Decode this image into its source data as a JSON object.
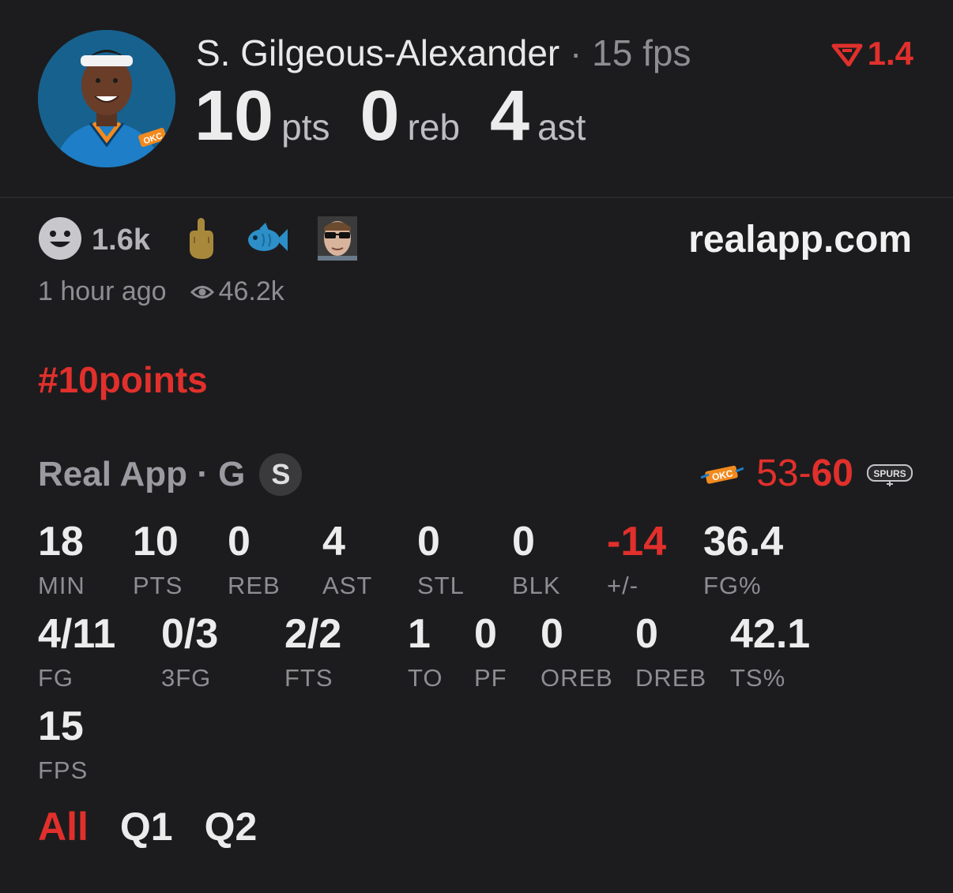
{
  "header": {
    "player_name": "S. Gilgeous-Alexander",
    "separator": "·",
    "fps_label": "15 fps",
    "pts": "10",
    "pts_unit": "pts",
    "reb": "0",
    "reb_unit": "reb",
    "ast": "4",
    "ast_unit": "ast",
    "delta": "1.4",
    "team_logo_text": "OKC"
  },
  "reactions": {
    "count": "1.6k",
    "items": [
      "smiley-icon",
      "middle-finger-icon",
      "fish-icon",
      "sunglasses-face-avatar"
    ]
  },
  "site": "realapp.com",
  "meta": {
    "time": "1 hour ago",
    "views": "46.2k"
  },
  "hashtag": "#10points",
  "game": {
    "source": "Real App · G",
    "badge": "S",
    "score_left": "53",
    "score_sep": "-",
    "score_right": "60",
    "home_logo": "OKC",
    "away_logo": "SPURS"
  },
  "stats_row1": [
    {
      "v": "18",
      "l": "MIN"
    },
    {
      "v": "10",
      "l": "PTS"
    },
    {
      "v": "0",
      "l": "REB"
    },
    {
      "v": "4",
      "l": "AST"
    },
    {
      "v": "0",
      "l": "STL"
    },
    {
      "v": "0",
      "l": "BLK"
    },
    {
      "v": "-14",
      "l": "+/-"
    },
    {
      "v": "36.4",
      "l": "FG%"
    }
  ],
  "stats_row2": [
    {
      "v": "4/11",
      "l": "FG"
    },
    {
      "v": "0/3",
      "l": "3FG"
    },
    {
      "v": "2/2",
      "l": "FTS"
    },
    {
      "v": "1",
      "l": "TO"
    },
    {
      "v": "0",
      "l": "PF"
    },
    {
      "v": "0",
      "l": "OREB"
    },
    {
      "v": "0",
      "l": "DREB"
    },
    {
      "v": "42.1",
      "l": "TS%"
    }
  ],
  "stats_row3": [
    {
      "v": "15",
      "l": "FPS"
    }
  ],
  "quarters": [
    "All",
    "Q1",
    "Q2"
  ],
  "colors": {
    "accent": "#e1302c",
    "bg": "#1c1c1e"
  }
}
